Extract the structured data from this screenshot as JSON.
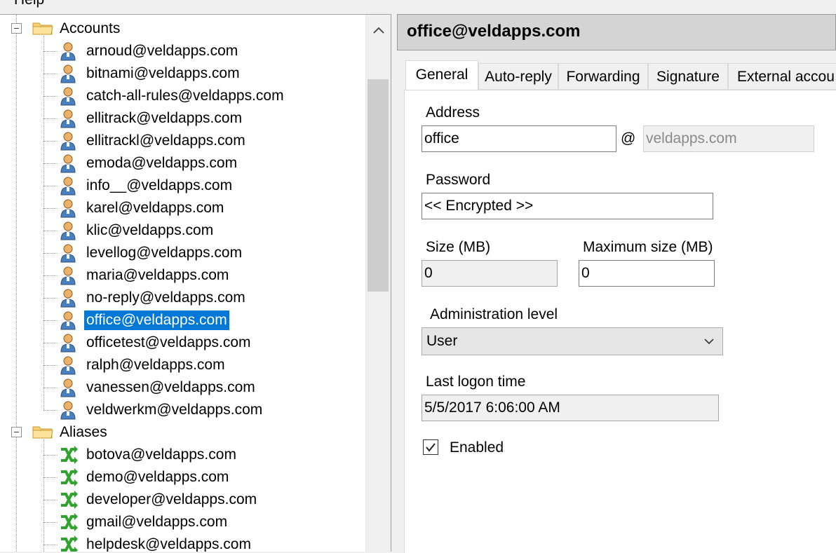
{
  "menu": {
    "help": "Help"
  },
  "tree": {
    "accounts_label": "Accounts",
    "accounts": [
      "arnoud@veldapps.com",
      "bitnami@veldapps.com",
      "catch-all-rules@veldapps.com",
      "ellitrack@veldapps.com",
      "ellitrackl@veldapps.com",
      "emoda@veldapps.com",
      "info__@veldapps.com",
      "karel@veldapps.com",
      "klic@veldapps.com",
      "levellog@veldapps.com",
      "maria@veldapps.com",
      "no-reply@veldapps.com",
      "office@veldapps.com",
      "officetest@veldapps.com",
      "ralph@veldapps.com",
      "vanessen@veldapps.com",
      "veldwerkm@veldapps.com"
    ],
    "selected_account": "office@veldapps.com",
    "aliases_label": "Aliases",
    "aliases": [
      "botova@veldapps.com",
      "demo@veldapps.com",
      "developer@veldapps.com",
      "gmail@veldapps.com",
      "helpdesk@veldapps.com"
    ],
    "expander_open": "−"
  },
  "detail": {
    "title": "office@veldapps.com",
    "tabs": [
      "General",
      "Auto-reply",
      "Forwarding",
      "Signature",
      "External accou"
    ],
    "active_tab": "General",
    "address_label": "Address",
    "address_value": "office",
    "at_sign": "@",
    "domain_value": "veldapps.com",
    "password_label": "Password",
    "password_value": "<< Encrypted >>",
    "size_label": "Size (MB)",
    "size_value": "0",
    "max_size_label": "Maximum size (MB)",
    "max_size_value": "0",
    "admin_level_label": "Administration level",
    "admin_level_value": "User",
    "last_logon_label": "Last logon time",
    "last_logon_value": "5/5/2017 6:06:00 AM",
    "enabled_label": "Enabled",
    "enabled_checked": true
  },
  "colors": {
    "selection": "#0078d7",
    "alias_icon": "#2da52d",
    "user_icon_skin": "#e9b26a"
  }
}
